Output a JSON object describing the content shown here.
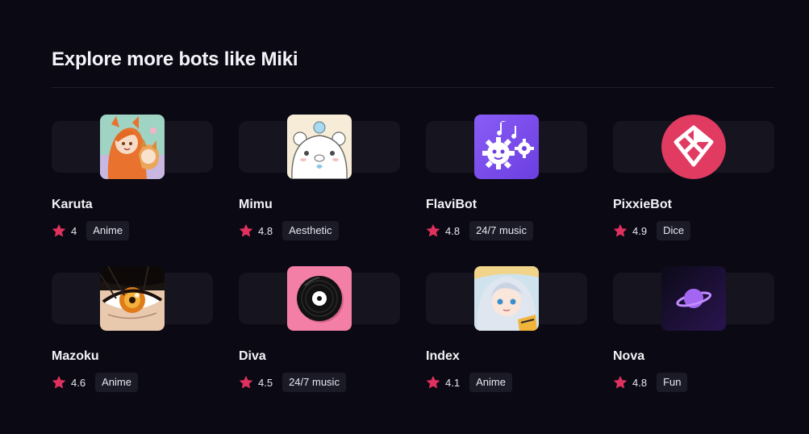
{
  "section": {
    "title": "Explore more bots like Miki"
  },
  "bots": [
    {
      "name": "Karuta",
      "rating": "4",
      "tag": "Anime",
      "avatar_icon": "anime-girls-avatar"
    },
    {
      "name": "Mimu",
      "rating": "4.8",
      "tag": "Aesthetic",
      "avatar_icon": "white-bear-avatar"
    },
    {
      "name": "FlaviBot",
      "rating": "4.8",
      "tag": "24/7 music",
      "avatar_icon": "gears-music-avatar"
    },
    {
      "name": "PixxieBot",
      "rating": "4.9",
      "tag": "Dice",
      "avatar_icon": "pink-dice-logo-avatar"
    },
    {
      "name": "Mazoku",
      "rating": "4.6",
      "tag": "Anime",
      "avatar_icon": "anime-eye-avatar"
    },
    {
      "name": "Diva",
      "rating": "4.5",
      "tag": "24/7 music",
      "avatar_icon": "vinyl-record-avatar"
    },
    {
      "name": "Index",
      "rating": "4.1",
      "tag": "Anime",
      "avatar_icon": "anime-silver-hair-avatar"
    },
    {
      "name": "Nova",
      "rating": "4.8",
      "tag": "Fun",
      "avatar_icon": "planet-avatar"
    }
  ],
  "colors": {
    "background": "#0b0a14",
    "card": "#15141f",
    "tag_bg": "#1b1a27",
    "star": "#e0315e"
  }
}
